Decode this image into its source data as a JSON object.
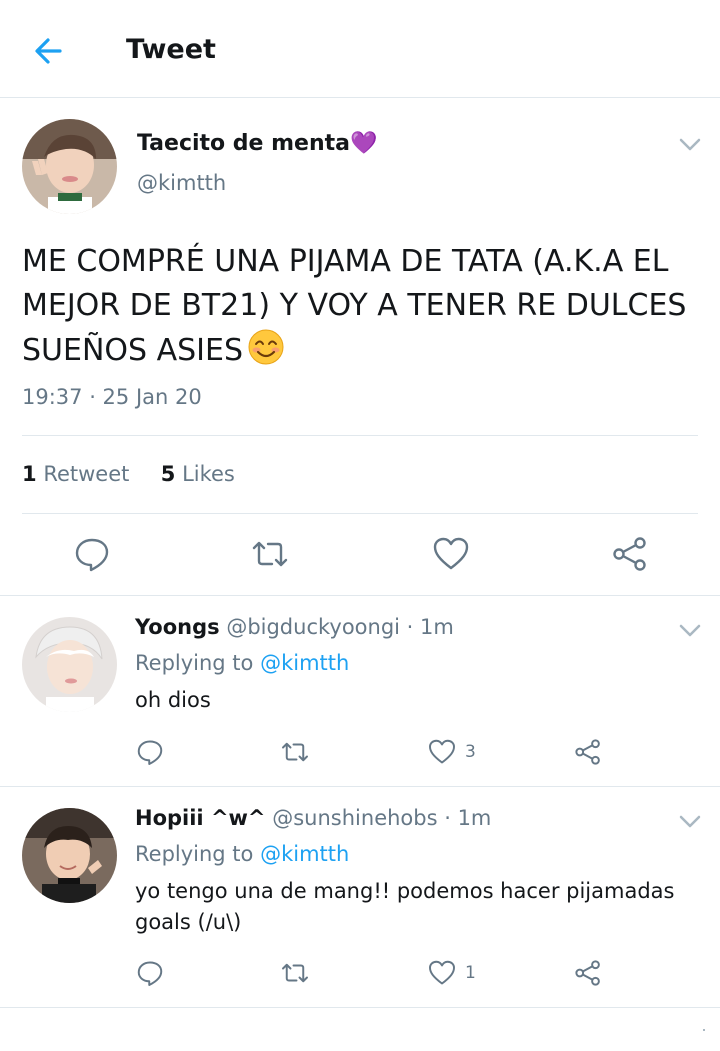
{
  "header": {
    "title": "Tweet"
  },
  "tweet": {
    "display_name": "Taecito de menta💜",
    "handle": "@kimtth",
    "text": "ME COMPRÉ UNA PIJAMA DE TATA (A.K.A EL MEJOR DE BT21) Y VOY A TENER RE DULCES SUEÑOS ASIES",
    "timestamp": "19:37 · 25 Jan 20",
    "retweets_count": "1",
    "retweets_label": "Retweet",
    "likes_count": "5",
    "likes_label": "Likes"
  },
  "replies": [
    {
      "name": "Yoongs",
      "handle_time": "@bigduckyoongi · 1m",
      "replying_prefix": "Replying to",
      "replying_to": "@kimtth",
      "text": "oh dios",
      "likes": "3"
    },
    {
      "name": "Hopiii ^w^",
      "handle_time": "@sunshinehobs · 1m",
      "replying_prefix": "Replying to",
      "replying_to": "@kimtth",
      "text": "yo tengo una de mang!! podemos hacer pijamadas goals (/u\\)",
      "likes": "1"
    }
  ],
  "colors": {
    "accent": "#1da1f2",
    "secondary_text": "#657786",
    "icon": "#657786",
    "divider": "#e1e8ed"
  },
  "icons": {
    "back": "arrow-left-icon",
    "caret": "chevron-down-icon",
    "reply": "comment-icon",
    "retweet": "retweet-icon",
    "like": "heart-icon",
    "share": "share-icon",
    "emoji": "smiling-face-emoji"
  }
}
